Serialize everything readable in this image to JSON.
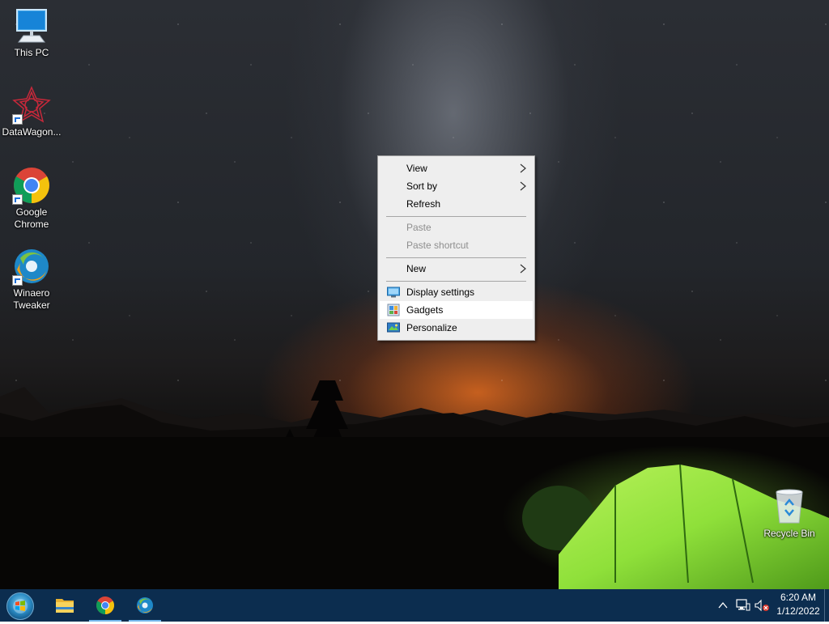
{
  "desktop": {
    "icons": [
      {
        "label": "This PC",
        "icon": "computer-icon"
      },
      {
        "label": "DataWagon...",
        "icon": "datawagon-icon"
      },
      {
        "label": "Google Chrome",
        "icon": "chrome-icon"
      },
      {
        "label": "Winaero Tweaker",
        "icon": "winaero-icon"
      },
      {
        "label": "Recycle Bin",
        "icon": "recycle-bin-icon"
      }
    ]
  },
  "context_menu": {
    "items": [
      {
        "label": "View",
        "submenu": true
      },
      {
        "label": "Sort by",
        "submenu": true
      },
      {
        "label": "Refresh"
      },
      {
        "label": "Paste",
        "disabled": true
      },
      {
        "label": "Paste shortcut",
        "disabled": true
      },
      {
        "label": "New",
        "submenu": true
      },
      {
        "label": "Display settings",
        "icon": "display-icon"
      },
      {
        "label": "Gadgets",
        "icon": "gadgets-icon",
        "highlighted": true
      },
      {
        "label": "Personalize",
        "icon": "personalize-icon"
      }
    ]
  },
  "taskbar": {
    "apps": [
      {
        "name": "file-explorer",
        "icon": "folder-icon",
        "active": false
      },
      {
        "name": "google-chrome",
        "icon": "chrome-icon",
        "active": true
      },
      {
        "name": "winaero-tweaker",
        "icon": "winaero-icon",
        "active": true
      }
    ],
    "clock": {
      "time": "6:20 AM",
      "date": "1/12/2022"
    }
  },
  "colors": {
    "taskbar": "#0c2d4f",
    "menu_bg": "#eeeeee",
    "menu_highlight": "#ffffff",
    "disabled_text": "#8e8e8e",
    "tent": "#8fe03a"
  }
}
